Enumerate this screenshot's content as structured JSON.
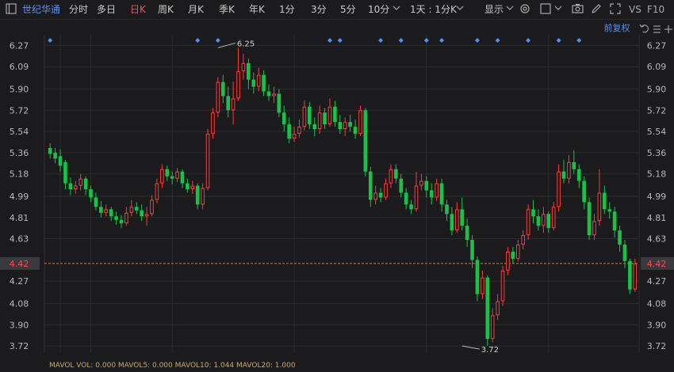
{
  "toolbar": {
    "stock_name": "世纪华通",
    "tabs": [
      "分时",
      "多日",
      "日K",
      "周K",
      "月K",
      "季K",
      "年K",
      "1分",
      "3分",
      "5分",
      "10分"
    ],
    "active_tab": "日K",
    "period_select": "1天 : 1分K",
    "display_label": "显示",
    "vs_label": "VS",
    "f10_label": "F10"
  },
  "chart_header": {
    "adjust_label": "前复权"
  },
  "volume_strip": {
    "text": "MAVOL VOL: 0.000 MAVOL5: 0.000 MAVOL10: 1.044 MAVOL20: 1.000"
  },
  "colors": {
    "up": "#ff3a3a",
    "down": "#17c24a",
    "background": "#1b1b1d",
    "grid": "#2c2c30",
    "price_line": "#e07a2a",
    "marker": "#4f93f0"
  },
  "chart_data": {
    "type": "candlestick",
    "y_ticks": [
      "6.27",
      "6.09",
      "5.90",
      "5.72",
      "5.54",
      "5.36",
      "5.18",
      "4.99",
      "4.81",
      "4.63",
      "4.42",
      "4.27",
      "4.08",
      "3.90",
      "3.72"
    ],
    "ylim": [
      3.66,
      6.36
    ],
    "current_price": 4.42,
    "current_price_label": "4.42",
    "max_annotation": {
      "label": "6.25",
      "value": 6.25,
      "index": 33
    },
    "min_annotation": {
      "label": "3.72",
      "value": 3.72,
      "index": 81
    },
    "marker_indices": [
      0,
      29,
      33,
      55,
      57,
      65,
      69,
      74,
      77,
      84,
      88,
      94,
      100,
      104
    ],
    "candles": [
      [
        5.4,
        5.35,
        5.44,
        5.31
      ],
      [
        5.36,
        5.31,
        5.4,
        5.27
      ],
      [
        5.33,
        5.25,
        5.39,
        5.2
      ],
      [
        5.28,
        5.1,
        5.3,
        5.05
      ],
      [
        5.1,
        5.05,
        5.15,
        5.0
      ],
      [
        5.05,
        5.08,
        5.12,
        5.01
      ],
      [
        5.08,
        5.14,
        5.18,
        5.04
      ],
      [
        5.14,
        5.05,
        5.16,
        5.0
      ],
      [
        5.05,
        4.98,
        5.08,
        4.94
      ],
      [
        4.98,
        4.9,
        5.02,
        4.87
      ],
      [
        4.9,
        4.85,
        4.95,
        4.81
      ],
      [
        4.85,
        4.88,
        4.92,
        4.82
      ],
      [
        4.88,
        4.82,
        4.9,
        4.78
      ],
      [
        4.82,
        4.79,
        4.86,
        4.75
      ],
      [
        4.79,
        4.76,
        4.83,
        4.72
      ],
      [
        4.76,
        4.85,
        4.9,
        4.74
      ],
      [
        4.85,
        4.9,
        4.96,
        4.82
      ],
      [
        4.9,
        4.87,
        4.94,
        4.84
      ],
      [
        4.87,
        4.82,
        4.92,
        4.78
      ],
      [
        4.82,
        4.84,
        4.9,
        4.74
      ],
      [
        4.84,
        4.96,
        5.0,
        4.82
      ],
      [
        4.96,
        5.1,
        5.14,
        4.93
      ],
      [
        5.1,
        5.22,
        5.26,
        5.06
      ],
      [
        5.22,
        5.16,
        5.25,
        5.12
      ],
      [
        5.16,
        5.14,
        5.2,
        5.09
      ],
      [
        5.14,
        5.2,
        5.23,
        5.11
      ],
      [
        5.2,
        5.1,
        5.22,
        5.06
      ],
      [
        5.1,
        5.05,
        5.14,
        5.02
      ],
      [
        5.05,
        5.08,
        5.12,
        5.01
      ],
      [
        5.08,
        4.92,
        5.1,
        4.88
      ],
      [
        4.92,
        5.06,
        5.1,
        4.88
      ],
      [
        5.06,
        5.52,
        5.56,
        5.04
      ],
      [
        5.52,
        5.7,
        5.74,
        5.48
      ],
      [
        5.7,
        5.96,
        6.0,
        5.66
      ],
      [
        5.96,
        5.84,
        6.02,
        5.78
      ],
      [
        5.84,
        5.72,
        5.92,
        5.66
      ],
      [
        5.72,
        5.82,
        5.96,
        5.6
      ],
      [
        5.82,
        6.05,
        6.25,
        5.8
      ],
      [
        6.05,
        6.12,
        6.2,
        5.98
      ],
      [
        6.12,
        5.98,
        6.16,
        5.9
      ],
      [
        5.98,
        5.92,
        6.04,
        5.86
      ],
      [
        5.92,
        6.02,
        6.08,
        5.88
      ],
      [
        6.02,
        5.88,
        6.06,
        5.84
      ],
      [
        5.88,
        5.84,
        5.94,
        5.8
      ],
      [
        5.84,
        5.86,
        5.92,
        5.78
      ],
      [
        5.86,
        5.7,
        5.9,
        5.66
      ],
      [
        5.7,
        5.6,
        5.76,
        5.54
      ],
      [
        5.6,
        5.48,
        5.66,
        5.44
      ],
      [
        5.48,
        5.52,
        5.58,
        5.45
      ],
      [
        5.52,
        5.58,
        5.64,
        5.49
      ],
      [
        5.58,
        5.75,
        5.8,
        5.55
      ],
      [
        5.75,
        5.6,
        5.79,
        5.56
      ],
      [
        5.6,
        5.56,
        5.66,
        5.5
      ],
      [
        5.56,
        5.7,
        5.76,
        5.52
      ],
      [
        5.7,
        5.6,
        5.74,
        5.56
      ],
      [
        5.6,
        5.75,
        5.82,
        5.58
      ],
      [
        5.75,
        5.62,
        5.8,
        5.58
      ],
      [
        5.62,
        5.56,
        5.68,
        5.52
      ],
      [
        5.56,
        5.62,
        5.66,
        5.5
      ],
      [
        5.62,
        5.58,
        5.68,
        5.54
      ],
      [
        5.58,
        5.52,
        5.64,
        5.48
      ],
      [
        5.52,
        5.72,
        5.76,
        5.5
      ],
      [
        5.72,
        5.2,
        5.74,
        5.16
      ],
      [
        5.2,
        4.96,
        5.24,
        4.9
      ],
      [
        4.96,
        5.02,
        5.08,
        4.92
      ],
      [
        5.02,
        4.98,
        5.06,
        4.94
      ],
      [
        4.98,
        5.1,
        5.14,
        4.96
      ],
      [
        5.1,
        5.22,
        5.26,
        5.06
      ],
      [
        5.22,
        5.14,
        5.26,
        5.1
      ],
      [
        5.14,
        5.02,
        5.18,
        4.98
      ],
      [
        5.02,
        4.92,
        5.06,
        4.88
      ],
      [
        4.92,
        4.88,
        4.96,
        4.84
      ],
      [
        4.88,
        5.08,
        5.2,
        4.86
      ],
      [
        5.08,
        5.12,
        5.18,
        5.04
      ],
      [
        5.12,
        5.04,
        5.16,
        4.98
      ],
      [
        5.04,
        4.98,
        5.1,
        4.92
      ],
      [
        4.98,
        5.1,
        5.14,
        4.95
      ],
      [
        5.1,
        4.92,
        5.14,
        4.86
      ],
      [
        4.92,
        4.84,
        4.96,
        4.78
      ],
      [
        4.84,
        4.7,
        4.9,
        4.66
      ],
      [
        4.7,
        4.88,
        4.94,
        4.68
      ],
      [
        4.88,
        4.74,
        4.98,
        4.7
      ],
      [
        4.74,
        4.62,
        4.8,
        4.56
      ],
      [
        4.62,
        4.45,
        4.66,
        4.38
      ],
      [
        4.45,
        4.16,
        4.48,
        4.1
      ],
      [
        4.16,
        4.3,
        4.36,
        4.12
      ],
      [
        4.3,
        3.78,
        4.32,
        3.72
      ],
      [
        3.78,
        3.98,
        4.04,
        3.75
      ],
      [
        3.98,
        4.1,
        4.16,
        3.94
      ],
      [
        4.1,
        4.36,
        4.4,
        4.06
      ],
      [
        4.36,
        4.52,
        4.56,
        4.32
      ],
      [
        4.52,
        4.46,
        4.56,
        4.42
      ],
      [
        4.46,
        4.58,
        4.62,
        4.44
      ],
      [
        4.58,
        4.66,
        4.7,
        4.54
      ],
      [
        4.66,
        4.88,
        4.92,
        4.62
      ],
      [
        4.88,
        4.82,
        4.96,
        4.76
      ],
      [
        4.82,
        4.74,
        4.88,
        4.7
      ],
      [
        4.74,
        4.84,
        4.9,
        4.68
      ],
      [
        4.84,
        4.72,
        4.86,
        4.68
      ],
      [
        4.72,
        4.9,
        4.94,
        4.7
      ],
      [
        4.9,
        5.2,
        5.26,
        4.86
      ],
      [
        5.2,
        5.14,
        5.3,
        5.1
      ],
      [
        5.14,
        5.28,
        5.34,
        5.1
      ],
      [
        5.28,
        5.22,
        5.38,
        5.18
      ],
      [
        5.22,
        5.12,
        5.26,
        5.06
      ],
      [
        5.12,
        4.94,
        5.16,
        4.88
      ],
      [
        4.94,
        4.66,
        4.98,
        4.62
      ],
      [
        4.66,
        4.78,
        4.84,
        4.62
      ],
      [
        4.78,
        5.02,
        5.22,
        4.74
      ],
      [
        5.02,
        4.88,
        5.08,
        4.84
      ],
      [
        4.88,
        4.86,
        4.94,
        4.8
      ],
      [
        4.86,
        4.7,
        4.9,
        4.64
      ],
      [
        4.7,
        4.58,
        4.74,
        4.52
      ],
      [
        4.58,
        4.44,
        4.62,
        4.38
      ],
      [
        4.44,
        4.2,
        4.46,
        4.16
      ],
      [
        4.2,
        4.42,
        4.46,
        4.18
      ]
    ]
  }
}
